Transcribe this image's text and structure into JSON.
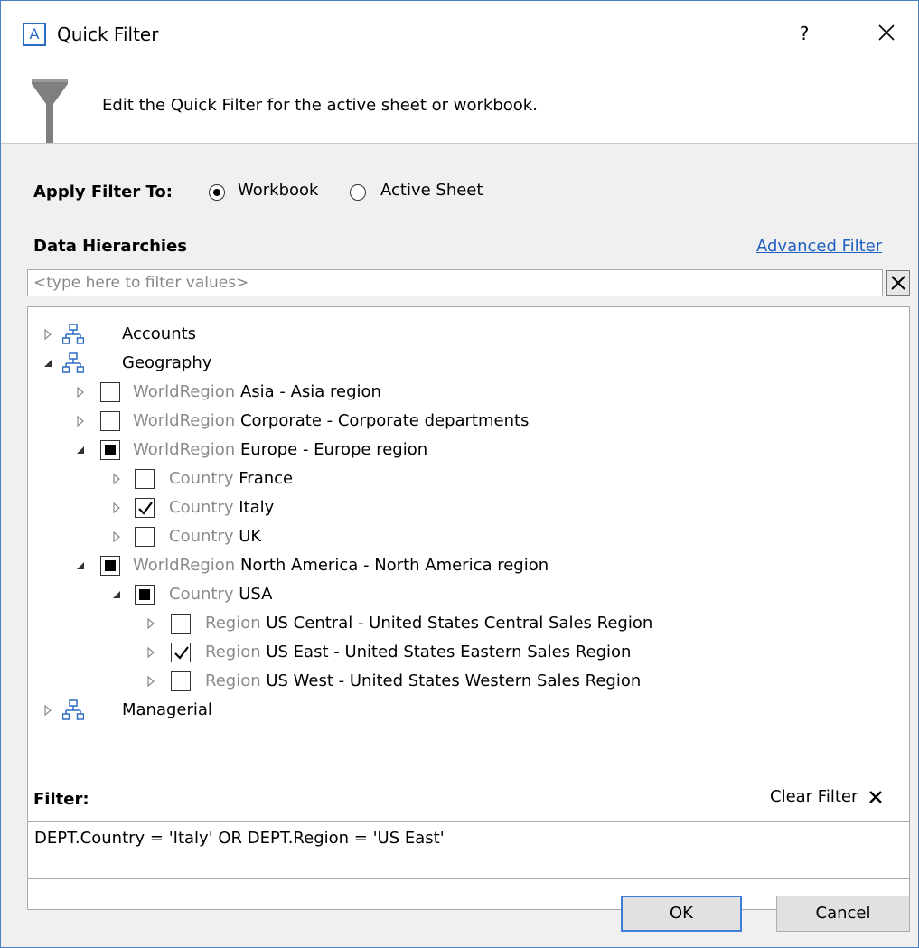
{
  "window": {
    "app_icon_letter": "A",
    "title": "Quick Filter",
    "help_label": "?"
  },
  "header": {
    "description": "Edit the Quick Filter for the active sheet or workbook."
  },
  "apply": {
    "label": "Apply Filter To:",
    "options": [
      {
        "label": "Workbook",
        "selected": true
      },
      {
        "label": "Active Sheet",
        "selected": false
      }
    ]
  },
  "hierarchies": {
    "label": "Data Hierarchies",
    "advanced_link": "Advanced Filter",
    "search_placeholder": "<type here to filter values>",
    "search_value": "",
    "tree": [
      {
        "kind": "hierarchy",
        "name": "Accounts",
        "expanded": false
      },
      {
        "kind": "hierarchy",
        "name": "Geography",
        "expanded": true
      },
      {
        "kind": "member",
        "level": "WorldRegion",
        "value": "Asia - Asia region",
        "state": "unchecked",
        "expanded": false
      },
      {
        "kind": "member",
        "level": "WorldRegion",
        "value": "Corporate - Corporate departments",
        "state": "unchecked",
        "expanded": false
      },
      {
        "kind": "member",
        "level": "WorldRegion",
        "value": "Europe - Europe region",
        "state": "partial",
        "expanded": true
      },
      {
        "kind": "member",
        "level": "Country",
        "value": "France",
        "state": "unchecked",
        "expanded": false
      },
      {
        "kind": "member",
        "level": "Country",
        "value": "Italy",
        "state": "checked",
        "expanded": false
      },
      {
        "kind": "member",
        "level": "Country",
        "value": "UK",
        "state": "unchecked",
        "expanded": false
      },
      {
        "kind": "member",
        "level": "WorldRegion",
        "value": "North America - North America region",
        "state": "partial",
        "expanded": true
      },
      {
        "kind": "member",
        "level": "Country",
        "value": "USA",
        "state": "partial",
        "expanded": true
      },
      {
        "kind": "member",
        "level": "Region",
        "value": "US Central - United States Central Sales Region",
        "state": "unchecked",
        "expanded": false
      },
      {
        "kind": "member",
        "level": "Region",
        "value": "US East - United States Eastern Sales Region",
        "state": "checked",
        "expanded": false
      },
      {
        "kind": "member",
        "level": "Region",
        "value": "US West - United States Western Sales Region",
        "state": "unchecked",
        "expanded": false
      },
      {
        "kind": "hierarchy",
        "name": "Managerial",
        "expanded": false
      }
    ]
  },
  "filter": {
    "label": "Filter:",
    "clear_label": "Clear Filter",
    "expression": "DEPT.Country = 'Italy' OR DEPT.Region = 'US East'"
  },
  "buttons": {
    "ok": "OK",
    "cancel": "Cancel"
  },
  "colors": {
    "accent": "#2d6cc4",
    "link": "#1f5fbf",
    "level_text": "#8a8a8a",
    "panel_bg": "#f0f0f0"
  }
}
